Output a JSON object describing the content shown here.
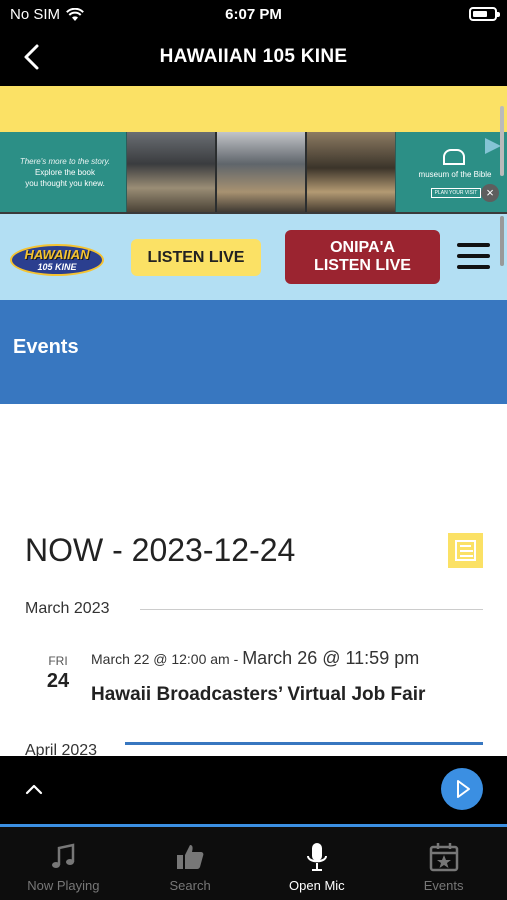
{
  "status": {
    "carrier": "No SIM",
    "time": "6:07 PM"
  },
  "nav": {
    "title": "HAWAIIAN 105 KINE"
  },
  "ad": {
    "tagline": "There's more to the story.",
    "line1": "Explore the book",
    "line2": "you thought you knew.",
    "brand": "museum of the Bible",
    "cta": "PLAN YOUR VISIT"
  },
  "site_header": {
    "logo_text": "HAWAIIAN",
    "logo_sub": "105 KINE",
    "listen_live": "LISTEN LIVE",
    "onipaa_line1": "ONIPA'A",
    "onipaa_line2": "LISTEN LIVE"
  },
  "banner": {
    "title": "Events"
  },
  "events": {
    "range_title": "NOW - 2023-12-24",
    "months": [
      {
        "label": "March 2023",
        "items": [
          {
            "dow": "FRI",
            "day": "24",
            "start": "March 22 @ 12:00 am",
            "separator": " - ",
            "end": "March 26 @ 11:59 pm",
            "title": "Hawaii Broadcasters’ Virtual Job Fair"
          }
        ]
      },
      {
        "label": "April 2023"
      }
    ]
  },
  "tabs": [
    {
      "label": "Now Playing",
      "icon": "music-note-icon",
      "active": false
    },
    {
      "label": "Search",
      "icon": "thumbs-up-icon",
      "active": false
    },
    {
      "label": "Open Mic",
      "icon": "microphone-icon",
      "active": true
    },
    {
      "label": "Events",
      "icon": "calendar-star-icon",
      "active": false
    }
  ],
  "colors": {
    "accent_blue": "#3b8fe2",
    "banner_blue": "#3877c0",
    "header_sky": "#b3dff3",
    "listen_yellow": "#fbe165",
    "onipaa_red": "#9b2430"
  }
}
